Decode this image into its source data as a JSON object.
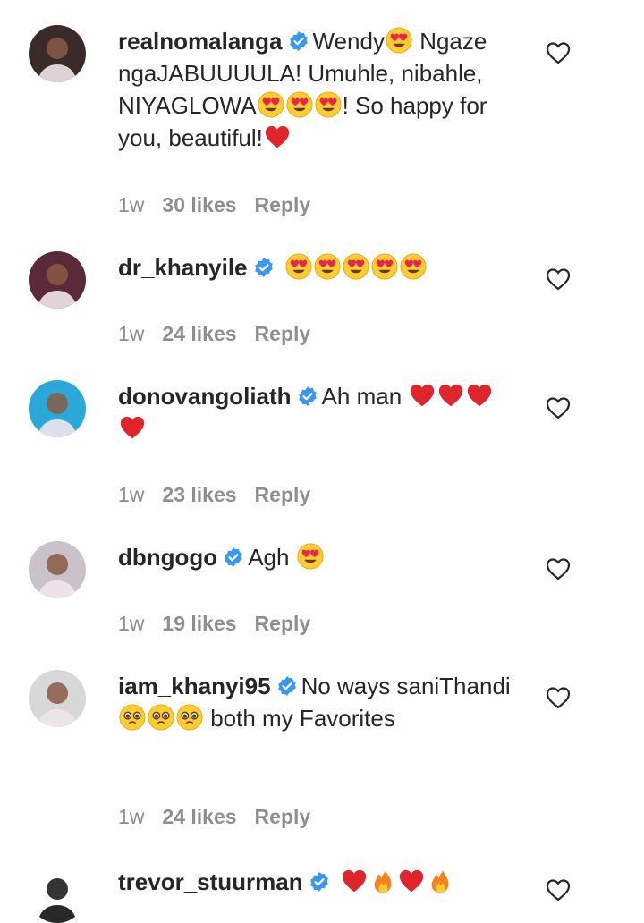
{
  "comments": [
    {
      "username": "realnomalanga",
      "verified": true,
      "parts": [
        {
          "t": "Wendy"
        },
        {
          "e": "heart-eyes"
        },
        {
          "t": " Ngaze ngaJABUUUULA! Umuhle, nibahle, NIYAGLOWA"
        },
        {
          "e": "heart-eyes"
        },
        {
          "e": "heart-eyes"
        },
        {
          "e": "heart-eyes"
        },
        {
          "t": "! So happy for you, beautiful!"
        },
        {
          "e": "red-heart"
        }
      ],
      "time": "1w",
      "likes": "30 likes",
      "reply": "Reply",
      "avatar_color": "#3a2a2a"
    },
    {
      "username": "dr_khanyile",
      "verified": true,
      "parts": [
        {
          "t": " "
        },
        {
          "e": "heart-eyes"
        },
        {
          "e": "heart-eyes"
        },
        {
          "e": "heart-eyes"
        },
        {
          "e": "heart-eyes"
        },
        {
          "e": "heart-eyes"
        }
      ],
      "time": "1w",
      "likes": "24 likes",
      "reply": "Reply",
      "avatar_color": "#5a2a3a"
    },
    {
      "username": "donovangoliath",
      "verified": true,
      "parts": [
        {
          "t": "Ah man "
        },
        {
          "e": "red-heart"
        },
        {
          "e": "red-heart"
        },
        {
          "e": "red-heart"
        },
        {
          "e": "red-heart"
        }
      ],
      "time": "1w",
      "likes": "23 likes",
      "reply": "Reply",
      "avatar_color": "#2aa8d8"
    },
    {
      "username": "dbngogo",
      "verified": true,
      "parts": [
        {
          "t": "Agh "
        },
        {
          "e": "heart-eyes"
        }
      ],
      "time": "1w",
      "likes": "19 likes",
      "reply": "Reply",
      "avatar_color": "#c9c2c9"
    },
    {
      "username": "iam_khanyi95",
      "verified": true,
      "parts": [
        {
          "t": "No ways saniThandi "
        },
        {
          "e": "pleading"
        },
        {
          "e": "pleading"
        },
        {
          "e": "pleading"
        },
        {
          "t": " both my Favorites"
        }
      ],
      "time": "1w",
      "likes": "24 likes",
      "reply": "Reply",
      "avatar_color": "#d8d8d8"
    },
    {
      "username": "trevor_stuurman",
      "verified": true,
      "parts": [
        {
          "t": " "
        },
        {
          "e": "red-heart"
        },
        {
          "e": "fire"
        },
        {
          "e": "red-heart"
        },
        {
          "e": "fire"
        }
      ],
      "time": "",
      "likes": "",
      "reply": "",
      "avatar_color": "#ffffff"
    }
  ],
  "colors": {
    "text": "#262626",
    "meta": "#8e8e8e",
    "verified": "#3897f0"
  }
}
